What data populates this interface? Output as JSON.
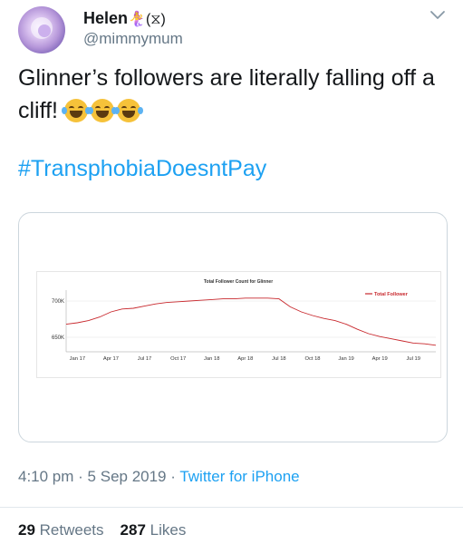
{
  "user": {
    "name": "Helen",
    "name_suffix": "🧜‍♀️(⧖)",
    "handle": "@mimmymum"
  },
  "tweet": {
    "text_line": "Glinner’s followers are literally falling off a cliff!",
    "emojis": [
      "face-with-tears-of-joy",
      "face-with-tears-of-joy",
      "face-with-tears-of-joy"
    ],
    "hashtag": "#TransphobiaDoesntPay"
  },
  "meta": {
    "time": "4:10 pm",
    "separator1": " · ",
    "date": "5 Sep 2019",
    "separator2": " · ",
    "source": "Twitter for iPhone"
  },
  "stats": {
    "retweets_count": "29",
    "retweets_label": "Retweets",
    "likes_count": "287",
    "likes_label": "Likes"
  },
  "colors": {
    "link": "#1da1f2",
    "muted": "#657786",
    "line": "#c8282d"
  },
  "chart_data": {
    "type": "line",
    "title": "Total Follower Count for Glinner",
    "legend": "Total Follower",
    "legend_position": "top-right",
    "grid": "horizontal",
    "categories": [
      "Jan 17",
      "Apr 17",
      "Jul 17",
      "Oct 17",
      "Jan 18",
      "Apr 18",
      "Jul 18",
      "Oct 18",
      "Jan 19",
      "Apr 19",
      "Jul 19"
    ],
    "y_ticks": [
      {
        "label": "700K",
        "value": 700000
      },
      {
        "label": "650K",
        "value": 650000
      }
    ],
    "ylim": [
      630000,
      715000
    ],
    "series": [
      {
        "name": "Total Follower",
        "x": [
          "2016-12",
          "2017-01",
          "2017-02",
          "2017-03",
          "2017-04",
          "2017-05",
          "2017-06",
          "2017-07",
          "2017-08",
          "2017-09",
          "2017-10",
          "2017-11",
          "2017-12",
          "2018-01",
          "2018-02",
          "2018-03",
          "2018-04",
          "2018-05",
          "2018-06",
          "2018-07",
          "2018-08",
          "2018-09",
          "2018-10",
          "2018-11",
          "2018-12",
          "2019-01",
          "2019-02",
          "2019-03",
          "2019-04",
          "2019-05",
          "2019-06",
          "2019-07",
          "2019-08",
          "2019-09"
        ],
        "values": [
          668000,
          670000,
          673000,
          678000,
          685000,
          689000,
          690000,
          693000,
          696000,
          698000,
          699000,
          700000,
          701000,
          702000,
          703000,
          703000,
          704000,
          704000,
          704000,
          703000,
          692000,
          685000,
          680000,
          676000,
          673000,
          668000,
          661000,
          655000,
          651000,
          648000,
          645000,
          642000,
          641000,
          639000
        ]
      }
    ]
  }
}
